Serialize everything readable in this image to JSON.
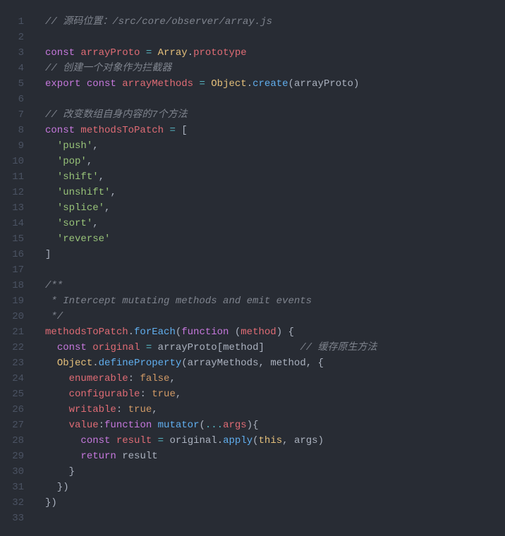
{
  "colors": {
    "background": "#282c34",
    "gutter": "#4b5363",
    "default": "#abb2bf",
    "comment": "#7f848e",
    "keyword": "#c678dd",
    "identifier": "#e06c75",
    "operator": "#56b6c2",
    "class": "#e5c07b",
    "function": "#61afef",
    "string": "#98c379",
    "literal": "#d19a66"
  },
  "line_numbers": [
    "1",
    "2",
    "3",
    "4",
    "5",
    "6",
    "7",
    "8",
    "9",
    "10",
    "11",
    "12",
    "13",
    "14",
    "15",
    "16",
    "17",
    "18",
    "19",
    "20",
    "21",
    "22",
    "23",
    "24",
    "25",
    "26",
    "27",
    "28",
    "29",
    "30",
    "31",
    "32",
    "33"
  ],
  "lines": [
    [
      {
        "t": "// 源码位置：/src/core/observer/array.js",
        "c": "c"
      }
    ],
    [],
    [
      {
        "t": "const ",
        "c": "kw"
      },
      {
        "t": "arrayProto",
        "c": "id"
      },
      {
        "t": " ",
        "c": "pn"
      },
      {
        "t": "=",
        "c": "op"
      },
      {
        "t": " ",
        "c": "pn"
      },
      {
        "t": "Array",
        "c": "cls"
      },
      {
        "t": ".",
        "c": "pn"
      },
      {
        "t": "prototype",
        "c": "id"
      }
    ],
    [
      {
        "t": "// 创建一个对象作为拦截器",
        "c": "c"
      }
    ],
    [
      {
        "t": "export ",
        "c": "kw"
      },
      {
        "t": "const ",
        "c": "kw"
      },
      {
        "t": "arrayMethods",
        "c": "id"
      },
      {
        "t": " ",
        "c": "pn"
      },
      {
        "t": "=",
        "c": "op"
      },
      {
        "t": " ",
        "c": "pn"
      },
      {
        "t": "Object",
        "c": "cls"
      },
      {
        "t": ".",
        "c": "pn"
      },
      {
        "t": "create",
        "c": "fn"
      },
      {
        "t": "(",
        "c": "pn"
      },
      {
        "t": "arrayProto",
        "c": "arg"
      },
      {
        "t": ")",
        "c": "pn"
      }
    ],
    [],
    [
      {
        "t": "// 改变数组自身内容的7个方法",
        "c": "c"
      }
    ],
    [
      {
        "t": "const ",
        "c": "kw"
      },
      {
        "t": "methodsToPatch",
        "c": "id"
      },
      {
        "t": " ",
        "c": "pn"
      },
      {
        "t": "=",
        "c": "op"
      },
      {
        "t": " [",
        "c": "pn"
      }
    ],
    [
      {
        "t": "  ",
        "c": "pn"
      },
      {
        "t": "'push'",
        "c": "str"
      },
      {
        "t": ",",
        "c": "pn"
      }
    ],
    [
      {
        "t": "  ",
        "c": "pn"
      },
      {
        "t": "'pop'",
        "c": "str"
      },
      {
        "t": ",",
        "c": "pn"
      }
    ],
    [
      {
        "t": "  ",
        "c": "pn"
      },
      {
        "t": "'shift'",
        "c": "str"
      },
      {
        "t": ",",
        "c": "pn"
      }
    ],
    [
      {
        "t": "  ",
        "c": "pn"
      },
      {
        "t": "'unshift'",
        "c": "str"
      },
      {
        "t": ",",
        "c": "pn"
      }
    ],
    [
      {
        "t": "  ",
        "c": "pn"
      },
      {
        "t": "'splice'",
        "c": "str"
      },
      {
        "t": ",",
        "c": "pn"
      }
    ],
    [
      {
        "t": "  ",
        "c": "pn"
      },
      {
        "t": "'sort'",
        "c": "str"
      },
      {
        "t": ",",
        "c": "pn"
      }
    ],
    [
      {
        "t": "  ",
        "c": "pn"
      },
      {
        "t": "'reverse'",
        "c": "str"
      }
    ],
    [
      {
        "t": "]",
        "c": "pn"
      }
    ],
    [],
    [
      {
        "t": "/**",
        "c": "c"
      }
    ],
    [
      {
        "t": " * Intercept mutating methods and emit events",
        "c": "c"
      }
    ],
    [
      {
        "t": " */",
        "c": "c"
      }
    ],
    [
      {
        "t": "methodsToPatch",
        "c": "id"
      },
      {
        "t": ".",
        "c": "pn"
      },
      {
        "t": "forEach",
        "c": "fn"
      },
      {
        "t": "(",
        "c": "pn"
      },
      {
        "t": "function ",
        "c": "kw"
      },
      {
        "t": "(",
        "c": "pn"
      },
      {
        "t": "method",
        "c": "id"
      },
      {
        "t": ") {",
        "c": "pn"
      }
    ],
    [
      {
        "t": "  ",
        "c": "pn"
      },
      {
        "t": "const ",
        "c": "kw"
      },
      {
        "t": "original",
        "c": "id"
      },
      {
        "t": " ",
        "c": "pn"
      },
      {
        "t": "=",
        "c": "op"
      },
      {
        "t": " ",
        "c": "pn"
      },
      {
        "t": "arrayProto",
        "c": "arg"
      },
      {
        "t": "[",
        "c": "pn"
      },
      {
        "t": "method",
        "c": "arg"
      },
      {
        "t": "]      ",
        "c": "pn"
      },
      {
        "t": "// 缓存原生方法",
        "c": "c"
      }
    ],
    [
      {
        "t": "  ",
        "c": "pn"
      },
      {
        "t": "Object",
        "c": "cls"
      },
      {
        "t": ".",
        "c": "pn"
      },
      {
        "t": "defineProperty",
        "c": "fn"
      },
      {
        "t": "(",
        "c": "pn"
      },
      {
        "t": "arrayMethods",
        "c": "arg"
      },
      {
        "t": ", ",
        "c": "pn"
      },
      {
        "t": "method",
        "c": "arg"
      },
      {
        "t": ", {",
        "c": "pn"
      }
    ],
    [
      {
        "t": "    ",
        "c": "pn"
      },
      {
        "t": "enumerable",
        "c": "id"
      },
      {
        "t": ": ",
        "c": "pn"
      },
      {
        "t": "false",
        "c": "lit"
      },
      {
        "t": ",",
        "c": "pn"
      }
    ],
    [
      {
        "t": "    ",
        "c": "pn"
      },
      {
        "t": "configurable",
        "c": "id"
      },
      {
        "t": ": ",
        "c": "pn"
      },
      {
        "t": "true",
        "c": "lit"
      },
      {
        "t": ",",
        "c": "pn"
      }
    ],
    [
      {
        "t": "    ",
        "c": "pn"
      },
      {
        "t": "writable",
        "c": "id"
      },
      {
        "t": ": ",
        "c": "pn"
      },
      {
        "t": "true",
        "c": "lit"
      },
      {
        "t": ",",
        "c": "pn"
      }
    ],
    [
      {
        "t": "    ",
        "c": "pn"
      },
      {
        "t": "value",
        "c": "id"
      },
      {
        "t": ":",
        "c": "pn"
      },
      {
        "t": "function ",
        "c": "kw"
      },
      {
        "t": "mutator",
        "c": "fn"
      },
      {
        "t": "(",
        "c": "pn"
      },
      {
        "t": "...",
        "c": "op"
      },
      {
        "t": "args",
        "c": "id"
      },
      {
        "t": "){",
        "c": "pn"
      }
    ],
    [
      {
        "t": "      ",
        "c": "pn"
      },
      {
        "t": "const ",
        "c": "kw"
      },
      {
        "t": "result",
        "c": "id"
      },
      {
        "t": " ",
        "c": "pn"
      },
      {
        "t": "=",
        "c": "op"
      },
      {
        "t": " ",
        "c": "pn"
      },
      {
        "t": "original",
        "c": "arg"
      },
      {
        "t": ".",
        "c": "pn"
      },
      {
        "t": "apply",
        "c": "fn"
      },
      {
        "t": "(",
        "c": "pn"
      },
      {
        "t": "this",
        "c": "cls"
      },
      {
        "t": ", ",
        "c": "pn"
      },
      {
        "t": "args",
        "c": "arg"
      },
      {
        "t": ")",
        "c": "pn"
      }
    ],
    [
      {
        "t": "      ",
        "c": "pn"
      },
      {
        "t": "return ",
        "c": "kw"
      },
      {
        "t": "result",
        "c": "arg"
      }
    ],
    [
      {
        "t": "    }",
        "c": "pn"
      }
    ],
    [
      {
        "t": "  })",
        "c": "pn"
      }
    ],
    [
      {
        "t": "})",
        "c": "pn"
      }
    ],
    []
  ]
}
